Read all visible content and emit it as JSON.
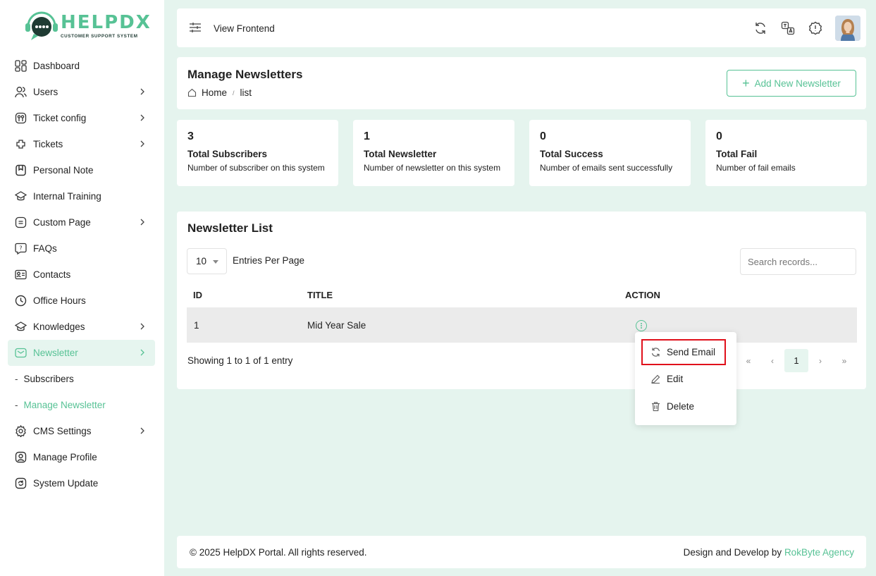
{
  "brand": {
    "title": "HELPDX",
    "subtitle": "CUSTOMER SUPPORT SYSTEM",
    "accent": "#57c295"
  },
  "sidebar": {
    "items": [
      {
        "label": "Dashboard",
        "icon": "dashboard-icon",
        "has_children": false
      },
      {
        "label": "Users",
        "icon": "users-icon",
        "has_children": true
      },
      {
        "label": "Ticket config",
        "icon": "ticket-config-icon",
        "has_children": true
      },
      {
        "label": "Tickets",
        "icon": "tickets-icon",
        "has_children": true
      },
      {
        "label": "Personal Note",
        "icon": "note-icon",
        "has_children": false
      },
      {
        "label": "Internal Training",
        "icon": "training-icon",
        "has_children": false
      },
      {
        "label": "Custom Page",
        "icon": "page-icon",
        "has_children": true
      },
      {
        "label": "FAQs",
        "icon": "faq-icon",
        "has_children": false
      },
      {
        "label": "Contacts",
        "icon": "contacts-icon",
        "has_children": false
      },
      {
        "label": "Office Hours",
        "icon": "clock-icon",
        "has_children": false
      },
      {
        "label": "Knowledges",
        "icon": "knowledge-icon",
        "has_children": true
      },
      {
        "label": "Newsletter",
        "icon": "newsletter-icon",
        "has_children": true,
        "active": true
      },
      {
        "label": "CMS Settings",
        "icon": "settings-icon",
        "has_children": true
      },
      {
        "label": "Manage Profile",
        "icon": "profile-icon",
        "has_children": false
      },
      {
        "label": "System Update",
        "icon": "update-icon",
        "has_children": false
      }
    ],
    "newsletter_sub": [
      {
        "label": "Subscribers"
      },
      {
        "label": "Manage Newsletter",
        "active": true
      }
    ]
  },
  "topbar": {
    "view_frontend": "View Frontend"
  },
  "header": {
    "title": "Manage Newsletters",
    "breadcrumb_home": "Home",
    "breadcrumb_current": "list",
    "add_button": "Add New Newsletter"
  },
  "stats": [
    {
      "value": "3",
      "label": "Total Subscribers",
      "desc": "Number of subscriber on this system"
    },
    {
      "value": "1",
      "label": "Total Newsletter",
      "desc": "Number of newsletter on this system"
    },
    {
      "value": "0",
      "label": "Total Success",
      "desc": "Number of emails sent successfully"
    },
    {
      "value": "0",
      "label": "Total Fail",
      "desc": "Number of fail emails"
    }
  ],
  "list": {
    "title": "Newsletter List",
    "per_page": "10",
    "per_page_label": "Entries Per Page",
    "search_placeholder": "Search records...",
    "columns": [
      "ID",
      "TITLE",
      "ACTION"
    ],
    "rows": [
      {
        "id": "1",
        "title": "Mid Year Sale"
      }
    ],
    "showing": "Showing 1 to 1 of 1 entry",
    "pager": {
      "first": "«",
      "prev": "‹",
      "current": "1",
      "next": "›",
      "last": "»"
    }
  },
  "action_menu": {
    "send_email": "Send Email",
    "edit": "Edit",
    "delete": "Delete"
  },
  "footer": {
    "copyright": "© 2025 HelpDX Portal. All rights reserved.",
    "design_prefix": "Design and Develop by",
    "agency": "RokByte Agency"
  }
}
